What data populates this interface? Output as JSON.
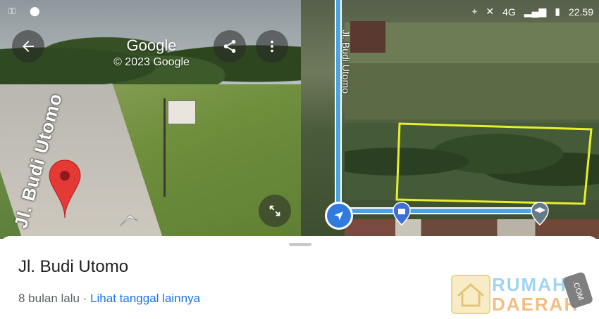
{
  "status_bar": {
    "time": "22.59",
    "network": "4G",
    "left_icons": [
      "key-icon",
      "location-pin-icon"
    ],
    "right_icons": [
      "location-icon",
      "mute-icon",
      "signal-icon",
      "battery-icon"
    ]
  },
  "street_view": {
    "brand": "Google",
    "copyright": "© 2023 Google",
    "road_label": "Jl. Budi Utomo"
  },
  "map": {
    "street_name": "Jl. Budi Utomo",
    "highlight_color": "#e6ef2a",
    "route_color": "#4aa3e8"
  },
  "sheet": {
    "title": "Jl. Budi Utomo",
    "date_text": "8 bulan lalu",
    "separator": " · ",
    "link_text": "Lihat tanggal lainnya"
  },
  "watermark": {
    "line1": "RUMAH",
    "line2": "DAERAH",
    "badge": ".COM"
  }
}
